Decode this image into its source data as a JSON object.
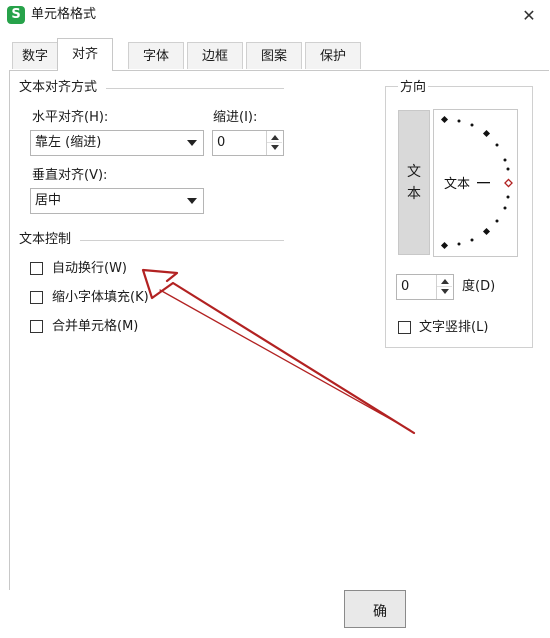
{
  "window": {
    "title": "单元格格式",
    "app_icon_letter": "S",
    "close_symbol": "✕"
  },
  "tabs": [
    {
      "label": "数字",
      "active": false
    },
    {
      "label": "对齐",
      "active": true
    },
    {
      "label": "字体",
      "active": false
    },
    {
      "label": "边框",
      "active": false
    },
    {
      "label": "图案",
      "active": false
    },
    {
      "label": "保护",
      "active": false
    }
  ],
  "alignment": {
    "section_title": "文本对齐方式",
    "horizontal_label": "水平对齐(H):",
    "horizontal_value": "靠左 (缩进)",
    "indent_label": "缩进(I):",
    "indent_value": "0",
    "vertical_label": "垂直对齐(V):",
    "vertical_value": "居中"
  },
  "text_control": {
    "section_title": "文本控制",
    "wrap_text": {
      "label": "自动换行(W)",
      "checked": false
    },
    "shrink_to_fit": {
      "label": "缩小字体填充(K)",
      "checked": false
    },
    "merge_cells": {
      "label": "合并单元格(M)",
      "checked": false
    }
  },
  "orientation": {
    "section_title": "方向",
    "vertical_text_chars": [
      "文",
      "本"
    ],
    "dial_text": "文本",
    "degree_value": "0",
    "degree_label": "度(D)",
    "vertical_stack": {
      "label": "文字竖排(L)",
      "checked": false
    }
  },
  "buttons": {
    "ok_label": "确"
  },
  "colors": {
    "app_icon": "#27a24a",
    "annotation_arrow": "#b22222",
    "dial_active_point": "#b22222"
  }
}
